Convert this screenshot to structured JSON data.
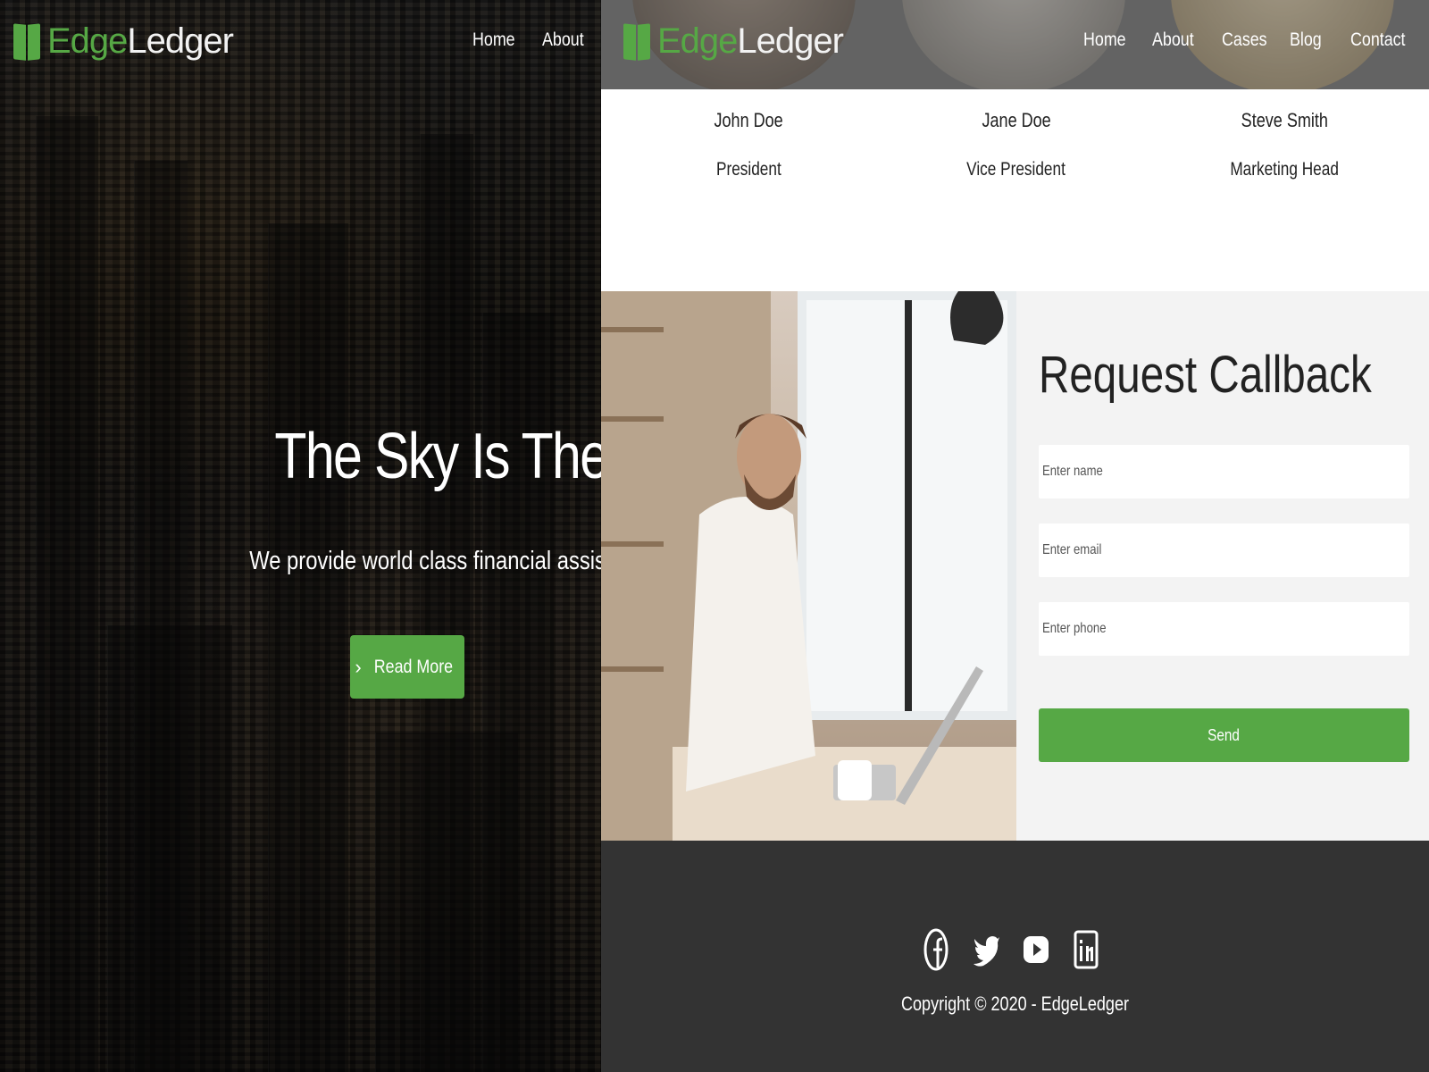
{
  "left_page": {
    "logo": {
      "part1": "Edge",
      "part2": "Ledger"
    },
    "nav": [
      "Home",
      "About"
    ],
    "hero": {
      "title": "The Sky Is The Limit",
      "subtitle": "We provide world class financial assistance",
      "button_label": "Read More"
    }
  },
  "right_page": {
    "logo": {
      "part1": "Edge",
      "part2": "Ledger"
    },
    "nav": [
      "Home",
      "About",
      "Cases",
      "Blog",
      "Contact"
    ],
    "team": [
      {
        "name": "John Doe",
        "role": "President"
      },
      {
        "name": "Jane Doe",
        "role": "Vice President"
      },
      {
        "name": "Steve Smith",
        "role": "Marketing Head"
      }
    ],
    "callback": {
      "title": "Request Callback",
      "name_placeholder": "Enter name",
      "email_placeholder": "Enter email",
      "phone_placeholder": "Enter phone",
      "send_label": "Send"
    },
    "footer": {
      "social_icons": [
        "facebook-icon",
        "twitter-icon",
        "youtube-icon",
        "linkedin-icon"
      ],
      "copyright": "Copyright © 2020 - EdgeLedger"
    }
  },
  "colors": {
    "brand_green": "#56a845",
    "footer_bg": "#333333",
    "form_bg": "#f3f3f3"
  }
}
